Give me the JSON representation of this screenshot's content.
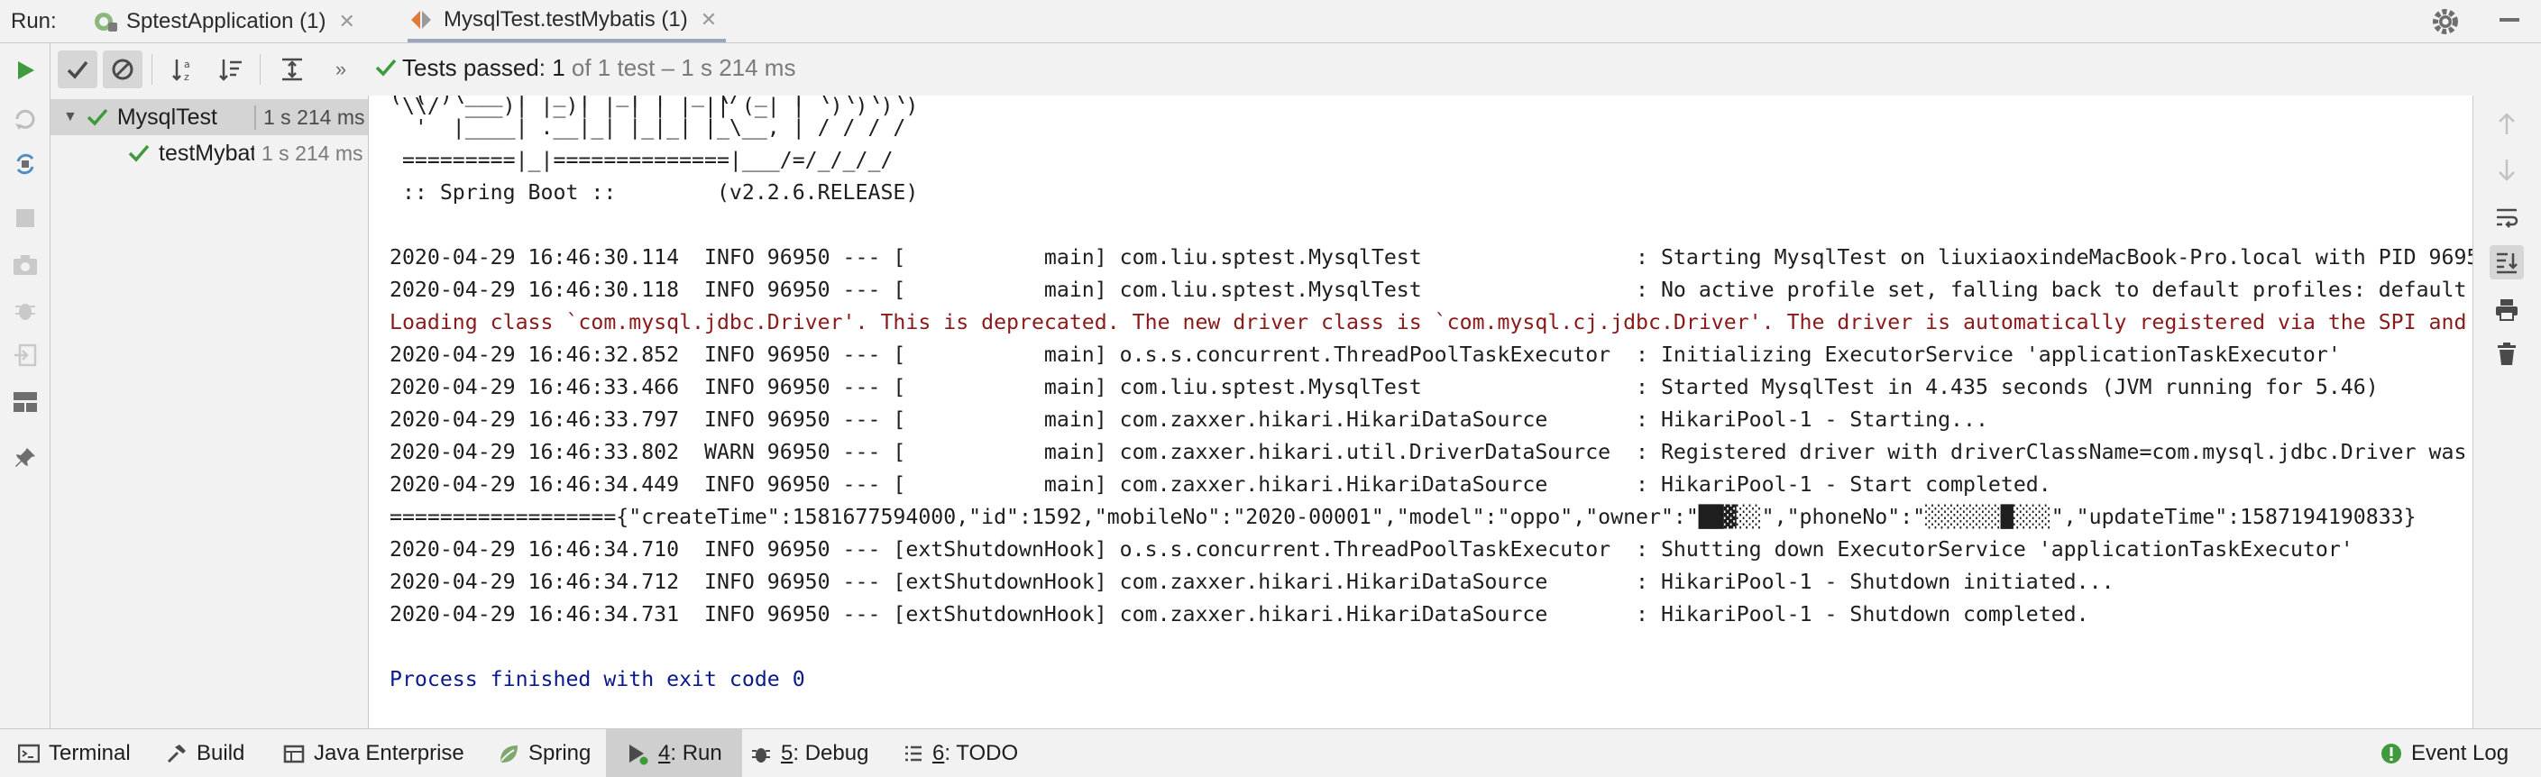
{
  "topbar": {
    "run_label": "Run:",
    "tabs": [
      {
        "label": "SptestApplication (1)",
        "icon": "spring-boot-icon"
      },
      {
        "label": "MysqlTest.testMybatis (1)",
        "icon": "junit-icon"
      }
    ]
  },
  "toolbar": {
    "status_prefix": "Tests passed: ",
    "status_count": "1",
    "status_rest": " of 1 test – 1 s 214 ms"
  },
  "tree": {
    "items": [
      {
        "name": "MysqlTest",
        "time": "1 s 214 ms"
      },
      {
        "name": "testMybatis",
        "time": "1 s 214 ms"
      }
    ]
  },
  "console": {
    "lines": [
      "( ( )\\___ | '_ | '_| | '_ \\/ _` | \\ \\ \\ \\",
      " \\\\/  ___)| |_)| | | | | || (_| |  ) ) ) )",
      "  '  |____| .__|_| |_|_| |_\\__, | / / / /",
      " =========|_|==============|___/=/_/_/_/",
      " :: Spring Boot ::        (v2.2.6.RELEASE)",
      "",
      "2020-04-29 16:46:30.114  INFO 96950 --- [           main] com.liu.sptest.MysqlTest                 : Starting MysqlTest on liuxiaoxindeMacBook-Pro.local with PID 96950",
      "2020-04-29 16:46:30.118  INFO 96950 --- [           main] com.liu.sptest.MysqlTest                 : No active profile set, falling back to default profiles: default",
      "Loading class `com.mysql.jdbc.Driver'. This is deprecated. The new driver class is `com.mysql.cj.jdbc.Driver'. The driver is automatically registered via the SPI and",
      "2020-04-29 16:46:32.852  INFO 96950 --- [           main] o.s.s.concurrent.ThreadPoolTaskExecutor  : Initializing ExecutorService 'applicationTaskExecutor'",
      "2020-04-29 16:46:33.466  INFO 96950 --- [           main] com.liu.sptest.MysqlTest                 : Started MysqlTest in 4.435 seconds (JVM running for 5.46)",
      "2020-04-29 16:46:33.797  INFO 96950 --- [           main] com.zaxxer.hikari.HikariDataSource       : HikariPool-1 - Starting...",
      "2020-04-29 16:46:33.802  WARN 96950 --- [           main] com.zaxxer.hikari.util.DriverDataSource  : Registered driver with driverClassName=com.mysql.jdbc.Driver was",
      "2020-04-29 16:46:34.449  INFO 96950 --- [           main] com.zaxxer.hikari.HikariDataSource       : HikariPool-1 - Start completed.",
      "=================={\"createTime\":1581677594000,\"id\":1592,\"mobileNo\":\"2020-00001\",\"model\":\"oppo\",\"owner\":\"██▓░░\",\"phoneNo\":\"░░░░░░█░░░\",\"updateTime\":1587194190833}",
      "2020-04-29 16:46:34.710  INFO 96950 --- [extShutdownHook] o.s.s.concurrent.ThreadPoolTaskExecutor  : Shutting down ExecutorService 'applicationTaskExecutor'",
      "2020-04-29 16:46:34.712  INFO 96950 --- [extShutdownHook] com.zaxxer.hikari.HikariDataSource       : HikariPool-1 - Shutdown initiated...",
      "2020-04-29 16:46:34.731  INFO 96950 --- [extShutdownHook] com.zaxxer.hikari.HikariDataSource       : HikariPool-1 - Shutdown completed.",
      "",
      "Process finished with exit code 0"
    ]
  },
  "bottombar": {
    "tabs": [
      {
        "label": "Terminal"
      },
      {
        "label": "Build"
      },
      {
        "label": "Java Enterprise"
      },
      {
        "label": "Spring"
      },
      {
        "key": "4",
        "label": ": Run"
      },
      {
        "key": "5",
        "label": ": Debug"
      },
      {
        "key": "6",
        "label": ": TODO"
      }
    ],
    "event_log": "Event Log"
  },
  "colors": {
    "pass_green": "#3e9a3a",
    "error_text": "#8a1a1a",
    "process_text": "#0b1a8a",
    "run_green": "#3e9a3a"
  }
}
